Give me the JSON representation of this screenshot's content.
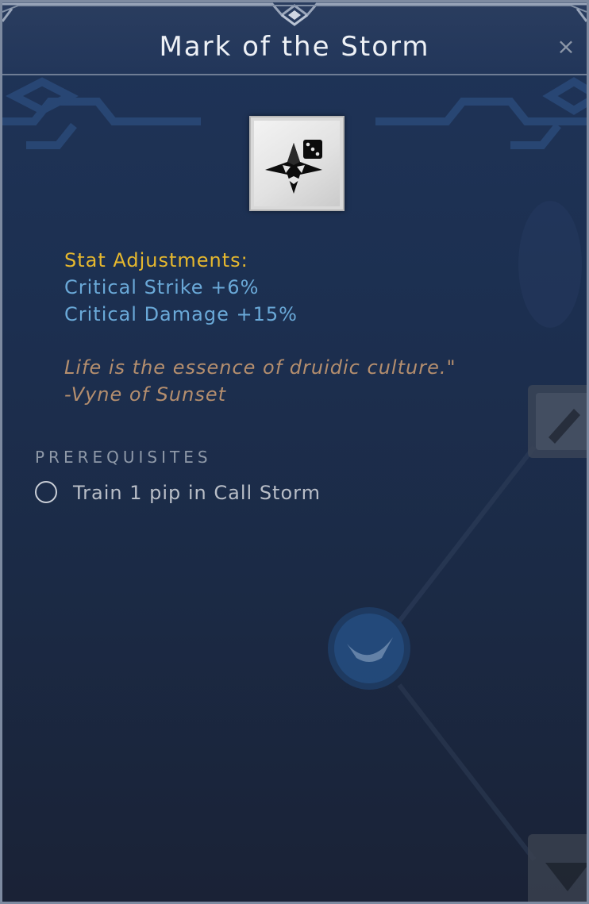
{
  "tooltip": {
    "title": "Mark of the Storm",
    "close_symbol": "×",
    "icon": "skill-star-dice-icon",
    "stats_heading": "Stat Adjustments:",
    "stats": [
      "Critical Strike +6%",
      "Critical Damage +15%"
    ],
    "quote_line1": "Life is the essence of druidic culture.\"",
    "quote_line2": "-Vyne of Sunset",
    "prerequisites_heading": "PREREQUISITES",
    "prerequisites": [
      {
        "text": "Train 1 pip in Call Storm",
        "completed": false
      }
    ]
  },
  "colors": {
    "title": "#eef1f6",
    "heading_gold": "#e6b82e",
    "stat_blue": "#6aa9d8",
    "quote_tan": "#b48e6e",
    "prereq_gray": "#b9bec7",
    "panel_bg": "#1c2f50"
  }
}
